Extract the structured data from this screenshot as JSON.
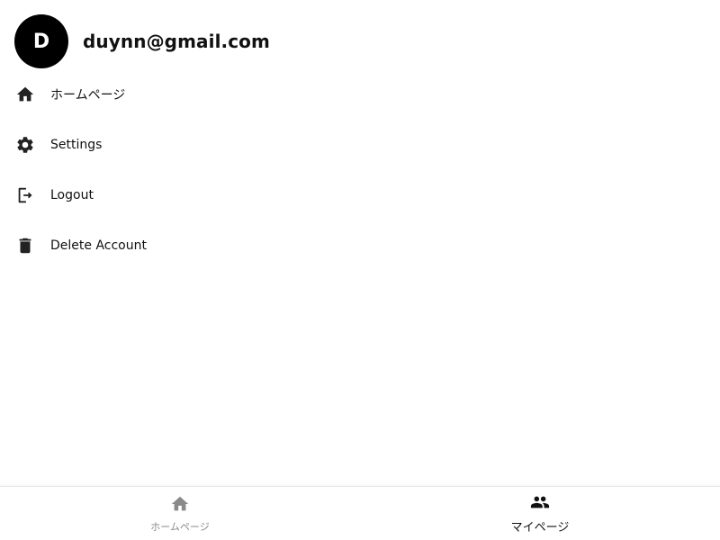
{
  "profile": {
    "avatar_initial": "D",
    "email": "duynn@gmail.com"
  },
  "menu": {
    "items": [
      {
        "label": "ホームページ",
        "icon": "home-icon"
      },
      {
        "label": "Settings",
        "icon": "gear-icon"
      },
      {
        "label": "Logout",
        "icon": "logout-icon"
      },
      {
        "label": "Delete Account",
        "icon": "trash-icon"
      }
    ]
  },
  "bottom_nav": {
    "tabs": [
      {
        "label": "ホームページ",
        "icon": "home-icon",
        "active": false
      },
      {
        "label": "マイページ",
        "icon": "people-icon",
        "active": true
      }
    ]
  },
  "colors": {
    "avatar_bg": "#000000",
    "text": "#111111",
    "inactive": "#8a8a8a"
  }
}
